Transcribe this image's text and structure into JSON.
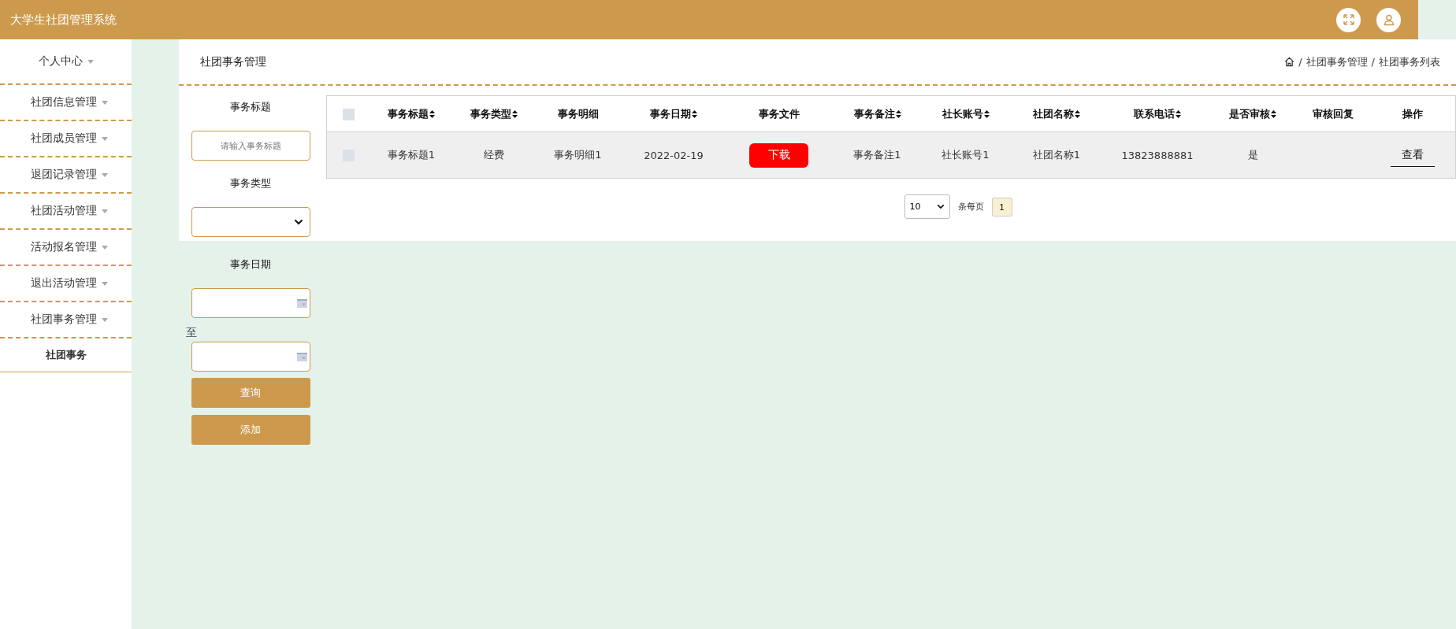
{
  "header": {
    "title": "大学生社团管理系统"
  },
  "sidebar": {
    "items": [
      {
        "label": "个人中心"
      },
      {
        "label": "社团信息管理"
      },
      {
        "label": "社团成员管理"
      },
      {
        "label": "退团记录管理"
      },
      {
        "label": "社团活动管理"
      },
      {
        "label": "活动报名管理"
      },
      {
        "label": "退出活动管理"
      },
      {
        "label": "社团事务管理",
        "children": [
          {
            "label": "社团事务"
          }
        ]
      }
    ]
  },
  "page": {
    "title": "社团事务管理",
    "breadcrumb": [
      {
        "separator": "/",
        "label": "社团事务管理"
      },
      {
        "separator": "/",
        "label": "社团事务列表"
      }
    ]
  },
  "filters": {
    "title_label": "事务标题",
    "title_placeholder": "请输入事务标题",
    "type_label": "事务类型",
    "date_label": "事务日期",
    "date_separator": "至",
    "search_button": "查询",
    "add_button": "添加"
  },
  "table": {
    "select_all": {
      "checked": false
    },
    "columns": [
      {
        "label": "事务标题",
        "sortable": true
      },
      {
        "label": "事务类型",
        "sortable": true
      },
      {
        "label": "事务明细",
        "sortable": false
      },
      {
        "label": "事务日期",
        "sortable": true
      },
      {
        "label": "事务文件",
        "sortable": false
      },
      {
        "label": "事务备注",
        "sortable": true
      },
      {
        "label": "社长账号",
        "sortable": true
      },
      {
        "label": "社团名称",
        "sortable": true
      },
      {
        "label": "联系电话",
        "sortable": true
      },
      {
        "label": "是否审核",
        "sortable": true
      },
      {
        "label": "审核回复",
        "sortable": false
      },
      {
        "label": "操作",
        "sortable": false
      }
    ],
    "rows": [
      {
        "checked": false,
        "cells": [
          {
            "kind": "text",
            "text": "事务标题1"
          },
          {
            "kind": "text",
            "text": "经费"
          },
          {
            "kind": "text",
            "text": "事务明细1"
          },
          {
            "kind": "text",
            "text": "2022-02-19"
          },
          {
            "kind": "button",
            "text": "下载"
          },
          {
            "kind": "text",
            "text": "事务备注1"
          },
          {
            "kind": "text",
            "text": "社长账号1"
          },
          {
            "kind": "text",
            "text": "社团名称1"
          },
          {
            "kind": "text",
            "text": "13823888881"
          },
          {
            "kind": "text",
            "text": "是"
          },
          {
            "kind": "blank"
          },
          {
            "kind": "link",
            "text": "查看"
          }
        ]
      }
    ]
  },
  "pagination": {
    "page_size": "10",
    "page_size_label": "条每页",
    "pages": [
      {
        "label": "1",
        "selected": true
      }
    ]
  }
}
